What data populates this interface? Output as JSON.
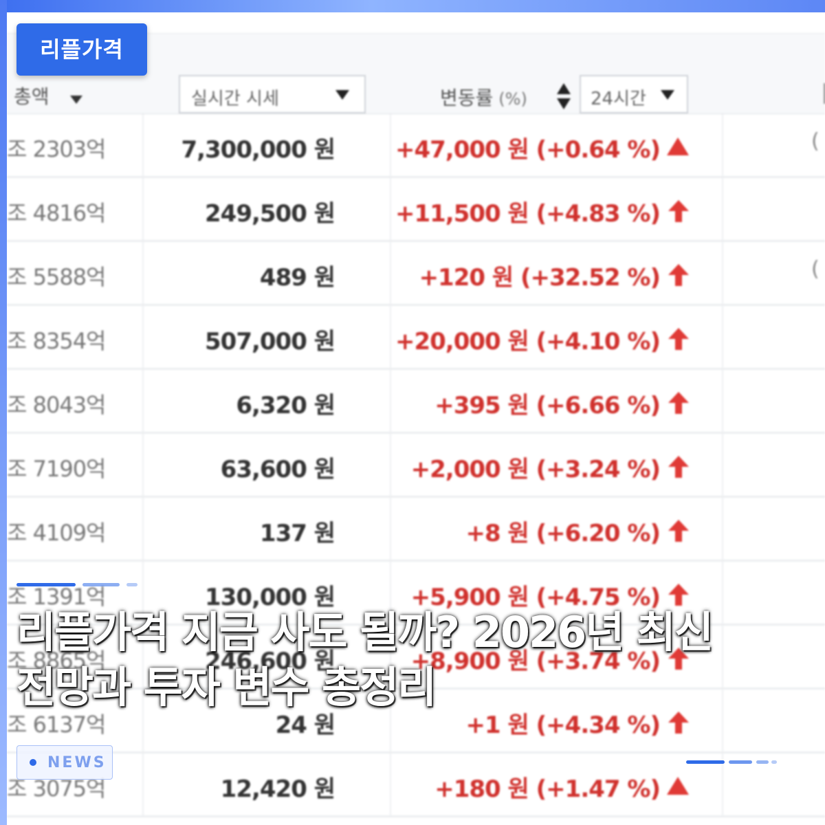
{
  "badge": {
    "label": "리플가격"
  },
  "table_header": {
    "cap_label": "총액",
    "select_value": "실시간 시세",
    "change_label": "변동률",
    "change_unit": "(%)",
    "period_value": "24시간"
  },
  "rows": [
    {
      "cap": "조 2303억",
      "price": "7,300,000 원",
      "change": "+47,000 원 (+0.64 %)",
      "arrow": "triangle",
      "clip": "("
    },
    {
      "cap": "조 4816억",
      "price": "249,500 원",
      "change": "+11,500 원 (+4.83 %)",
      "arrow": "up-arrow",
      "clip": ""
    },
    {
      "cap": "조 5588억",
      "price": "489 원",
      "change": "+120 원 (+32.52 %)",
      "arrow": "up-arrow",
      "clip": "("
    },
    {
      "cap": "조 8354억",
      "price": "507,000 원",
      "change": "+20,000 원 (+4.10 %)",
      "arrow": "up-arrow",
      "clip": ""
    },
    {
      "cap": "조 8043억",
      "price": "6,320 원",
      "change": "+395 원 (+6.66 %)",
      "arrow": "up-arrow",
      "clip": ""
    },
    {
      "cap": "조 7190억",
      "price": "63,600 원",
      "change": "+2,000 원 (+3.24 %)",
      "arrow": "up-arrow",
      "clip": ""
    },
    {
      "cap": "조 4109억",
      "price": "137 원",
      "change": "+8 원 (+6.20 %)",
      "arrow": "up-arrow",
      "clip": ""
    },
    {
      "cap": "조 1391억",
      "price": "130,000 원",
      "change": "+5,900 원 (+4.75 %)",
      "arrow": "up-arrow",
      "clip": ""
    },
    {
      "cap": "조 8865억",
      "price": "246,600 원",
      "change": "+8,900 원 (+3.74 %)",
      "arrow": "up-arrow",
      "clip": ""
    },
    {
      "cap": "조 6137억",
      "price": "24 원",
      "change": "+1 원 (+4.34 %)",
      "arrow": "up-arrow",
      "clip": ""
    },
    {
      "cap": "조 3075억",
      "price": "12,420 원",
      "change": "+180 원 (+1.47 %)",
      "arrow": "triangle",
      "clip": ""
    }
  ],
  "headline": {
    "line1": "리플가격 지금 사도 될까? 2026년 최신",
    "line2": "전망과 투자 변수 총정리"
  },
  "news_tag": {
    "label": "NEWS"
  },
  "colors": {
    "accent": "#2f6be8",
    "up": "#e03a36"
  },
  "icons": [
    "sort-icon",
    "chevron-down-icon",
    "triangle-up-icon",
    "arrow-up-icon"
  ]
}
